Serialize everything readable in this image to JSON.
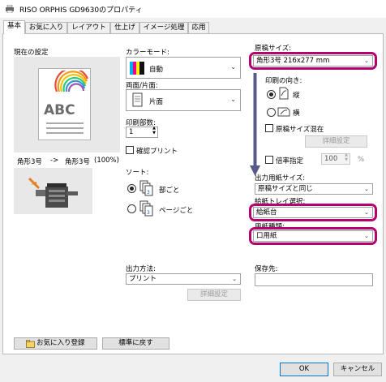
{
  "window": {
    "title": "RISO ORPHIS GD9630のプロパティ"
  },
  "tabs": [
    "基本",
    "お気に入り",
    "レイアウト",
    "仕上げ",
    "イメージ処理",
    "応用"
  ],
  "preview": {
    "heading": "現在の設定",
    "sample_text": "ABC",
    "original_size": "角形3号",
    "arrow": "->",
    "output_size": "角形3号",
    "scale": "(100%)"
  },
  "color_mode": {
    "label": "カラーモード:",
    "value": "自動"
  },
  "duplex": {
    "label": "両面/片面:",
    "value": "片面"
  },
  "copies": {
    "label": "印刷部数:",
    "value": "1"
  },
  "proof_print": {
    "label": "確認プリント",
    "checked": false
  },
  "sort": {
    "label": "ソート:",
    "options": [
      {
        "label": "部ごと",
        "selected": true
      },
      {
        "label": "ページごと",
        "selected": false
      }
    ]
  },
  "original_size": {
    "label": "原稿サイズ:",
    "value": "角形3号 216x277 mm"
  },
  "orientation": {
    "label": "印刷の向き:",
    "options": [
      {
        "label": "縦",
        "selected": true
      },
      {
        "label": "横",
        "selected": false
      }
    ]
  },
  "mixed_sizes": {
    "label": "原稿サイズ混在",
    "checked": false,
    "detail_button": "詳細設定"
  },
  "zoom": {
    "label": "倍率指定",
    "checked": false,
    "value": "100",
    "unit": "%"
  },
  "output_paper_size": {
    "label": "出力用紙サイズ:",
    "value": "原稿サイズと同じ"
  },
  "paper_tray": {
    "label": "給紙トレイ選択:",
    "value": "給紙台"
  },
  "paper_type": {
    "label": "用紙種類:",
    "value": "口用紙"
  },
  "output_method": {
    "label": "出力方法:",
    "value": "プリント",
    "detail_button": "詳細設定"
  },
  "save_to": {
    "label": "保存先:",
    "value": ""
  },
  "footer": {
    "add_favorite": "お気に入り登録",
    "restore_default": "標準に戻す",
    "ok": "OK",
    "cancel": "キャンセル"
  },
  "colors": {
    "highlight": "#b5006f",
    "primary_border": "#0078d7"
  }
}
